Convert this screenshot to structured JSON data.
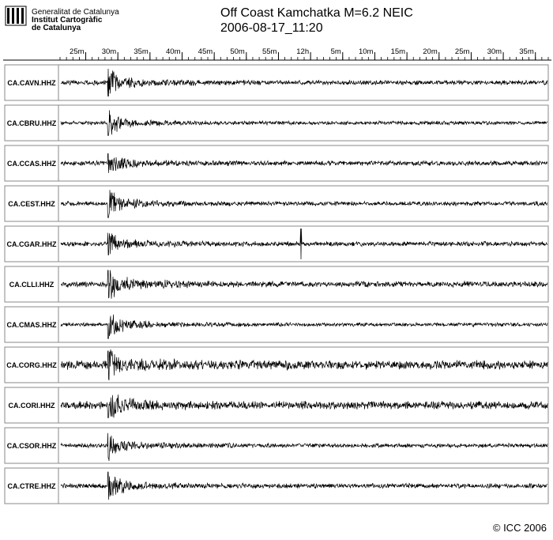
{
  "header": {
    "org_line1": "Generalitat de Catalunya",
    "org_line2": "Institut Cartogràfic",
    "org_line3": "de Catalunya",
    "title": "Off Coast Kamchatka M=6.2 NEIC",
    "subtitle": "2006-08-17_11:20"
  },
  "footer": {
    "copyright": "© ICC 2006"
  },
  "colors": {
    "trace": "#000000",
    "panel_border": "#888888",
    "background": "#ffffff"
  },
  "chart_data": {
    "type": "line",
    "title": "Off Coast Kamchatka M=6.2 NEIC",
    "subtitle": "2006-08-17_11:20",
    "x_axis": {
      "position": "top",
      "range_minutes": [
        21,
        37
      ],
      "tick_labels": [
        "25m",
        "30m",
        "35m",
        "40m",
        "45m",
        "50m",
        "55m",
        "12h",
        "5m",
        "10m",
        "15m",
        "20m",
        "25m",
        "30m",
        "35m"
      ],
      "tick_values_minutes": [
        25,
        30,
        35,
        40,
        45,
        50,
        55,
        60,
        65,
        70,
        75,
        80,
        85,
        90,
        95
      ],
      "minor_tick_step_minutes": 1,
      "start_minute": 21,
      "end_minute": 97
    },
    "grid": false,
    "series": [
      {
        "name": "CA.CAVN.HHZ",
        "noise_level": 0.45,
        "arrival_minute": 28.5,
        "arrival_amplitude": 1.0,
        "spike_minute": null
      },
      {
        "name": "CA.CBRU.HHZ",
        "noise_level": 0.35,
        "arrival_minute": 28.5,
        "arrival_amplitude": 0.9,
        "spike_minute": null
      },
      {
        "name": "CA.CCAS.HHZ",
        "noise_level": 0.45,
        "arrival_minute": 28.5,
        "arrival_amplitude": 0.7,
        "spike_minute": null
      },
      {
        "name": "CA.CEST.HHZ",
        "noise_level": 0.4,
        "arrival_minute": 28.5,
        "arrival_amplitude": 1.0,
        "spike_minute": null
      },
      {
        "name": "CA.CGAR.HHZ",
        "noise_level": 0.45,
        "arrival_minute": 28.5,
        "arrival_amplitude": 0.8,
        "spike_minute": 58.5
      },
      {
        "name": "CA.CLLI.HHZ",
        "noise_level": 0.55,
        "arrival_minute": 28.5,
        "arrival_amplitude": 1.0,
        "spike_minute": null
      },
      {
        "name": "CA.CMAS.HHZ",
        "noise_level": 0.35,
        "arrival_minute": 28.5,
        "arrival_amplitude": 1.0,
        "spike_minute": null
      },
      {
        "name": "CA.CORG.HHZ",
        "noise_level": 0.85,
        "arrival_minute": 28.5,
        "arrival_amplitude": 1.0,
        "spike_minute": null
      },
      {
        "name": "CA.CORI.HHZ",
        "noise_level": 0.75,
        "arrival_minute": 28.5,
        "arrival_amplitude": 0.9,
        "spike_minute": null
      },
      {
        "name": "CA.CSOR.HHZ",
        "noise_level": 0.4,
        "arrival_minute": 28.5,
        "arrival_amplitude": 0.9,
        "spike_minute": null
      },
      {
        "name": "CA.CTRE.HHZ",
        "noise_level": 0.45,
        "arrival_minute": 28.5,
        "arrival_amplitude": 1.0,
        "spike_minute": null
      }
    ]
  }
}
